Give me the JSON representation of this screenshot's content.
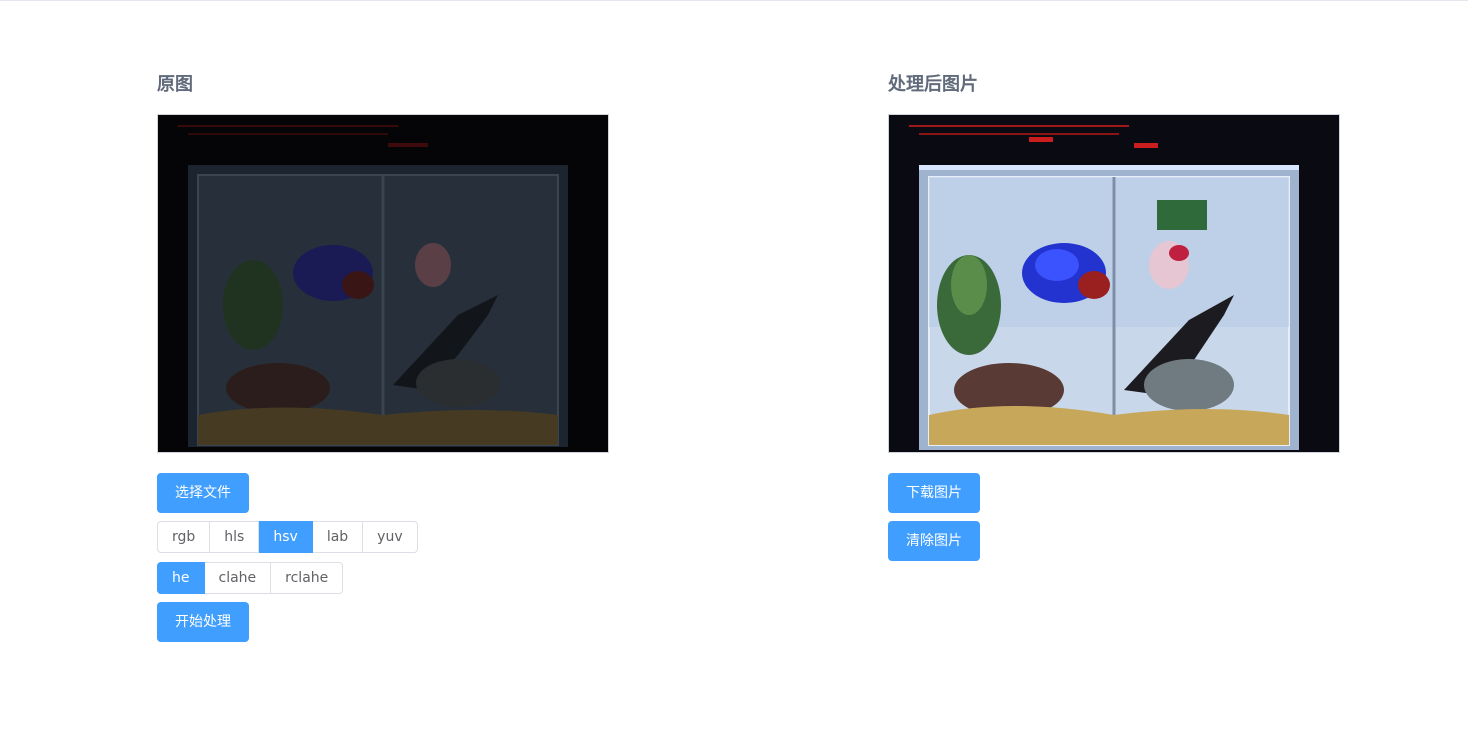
{
  "left": {
    "title": "原图",
    "choose_file": "选择文件",
    "color_spaces": [
      {
        "label": "rgb",
        "active": false
      },
      {
        "label": "hls",
        "active": false
      },
      {
        "label": "hsv",
        "active": true
      },
      {
        "label": "lab",
        "active": false
      },
      {
        "label": "yuv",
        "active": false
      }
    ],
    "methods": [
      {
        "label": "he",
        "active": true
      },
      {
        "label": "clahe",
        "active": false
      },
      {
        "label": "rclahe",
        "active": false
      }
    ],
    "start": "开始处理"
  },
  "right": {
    "title": "处理后图片",
    "download": "下载图片",
    "clear": "清除图片"
  },
  "colors": {
    "primary": "#409eff",
    "title": "#606a7b",
    "border": "#dcdfe6"
  }
}
